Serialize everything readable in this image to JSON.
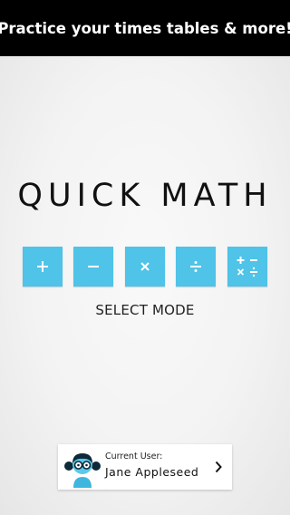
{
  "banner": {
    "text": "Practice your times tables & more!"
  },
  "app": {
    "title": "QUICK MATH"
  },
  "modes": [
    {
      "icon": "plus-icon",
      "label": "+"
    },
    {
      "icon": "minus-icon",
      "label": "−"
    },
    {
      "icon": "multiply-icon",
      "label": "×"
    },
    {
      "icon": "divide-icon",
      "label": "÷"
    },
    {
      "icon": "mixed-operations-icon",
      "label": "+ − × ÷"
    }
  ],
  "select_mode": {
    "label": "SELECT MODE"
  },
  "user": {
    "label": "Current User:",
    "name": "Jane Appleseed"
  },
  "colors": {
    "accent": "#4fc3e8",
    "banner_bg": "#000000",
    "banner_text": "#ffffff"
  }
}
